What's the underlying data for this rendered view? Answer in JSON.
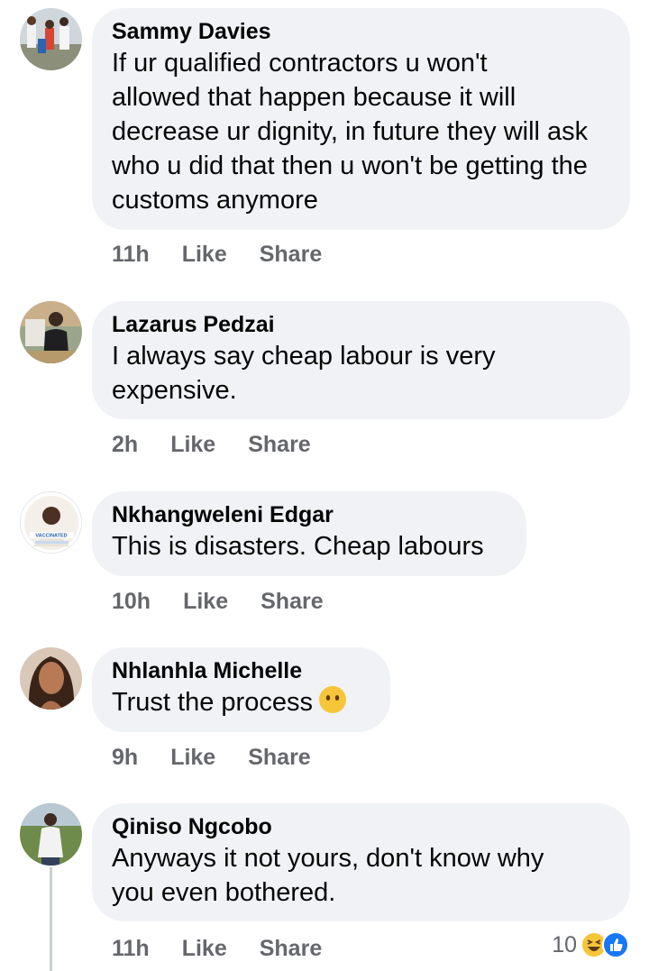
{
  "comments": [
    {
      "author": "Sammy Davies",
      "text": "If ur qualified contractors u won't\nallowed that happen because it will\ndecrease ur dignity, in future they will ask\nwho u did that then u won't be getting the\ncustoms anymore",
      "time": "11h",
      "like": "Like",
      "share": "Share"
    },
    {
      "author": "Lazarus Pedzai",
      "text": "I always say cheap labour is very\nexpensive.",
      "time": "2h",
      "like": "Like",
      "share": "Share"
    },
    {
      "author": "Nkhangweleni Edgar",
      "text": "This is disasters. Cheap labours",
      "time": "10h",
      "like": "Like",
      "share": "Share",
      "avatar_badge": "VACCINATED"
    },
    {
      "author": "Nhlanhla Michelle",
      "text": "Trust the process",
      "emoji": "neutral-face",
      "time": "9h",
      "like": "Like",
      "share": "Share"
    },
    {
      "author": "Qiniso Ngcobo",
      "text": "Anyways it not yours, don't know why\nyou even bothered.",
      "time": "11h",
      "like": "Like",
      "share": "Share",
      "reaction_count": "10",
      "reaction_icons": [
        "laughing-face-icon",
        "like-thumb-icon"
      ]
    }
  ],
  "colors": {
    "bubble": "#f0f2f5",
    "meta": "#65676b",
    "like_blue": "#1877f2",
    "emoji_yellow": "#f7c53a"
  }
}
